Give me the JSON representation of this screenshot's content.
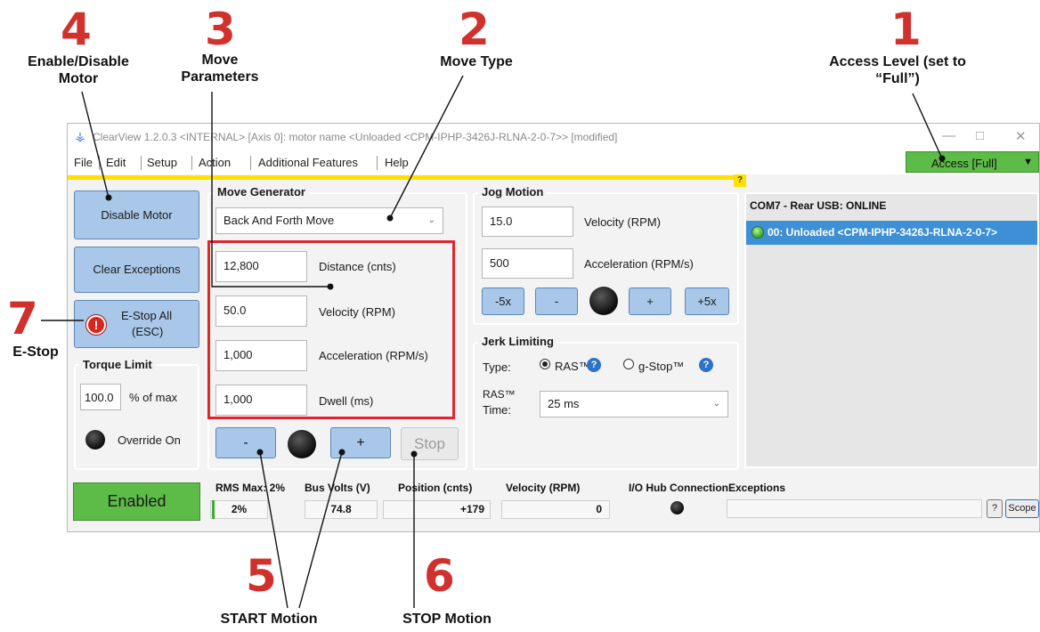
{
  "callouts": [
    {
      "num": "1",
      "label": "Access Level (set to “Full”)"
    },
    {
      "num": "2",
      "label": "Move Type"
    },
    {
      "num": "3",
      "label": "Move Parameters"
    },
    {
      "num": "4",
      "label": "Enable/Disable Motor"
    },
    {
      "num": "5",
      "label": "START Motion"
    },
    {
      "num": "6",
      "label": "STOP Motion"
    },
    {
      "num": "7",
      "label": "E-Stop"
    }
  ],
  "window": {
    "title": "ClearView 1.2.0.3 <INTERNAL> [Axis 0]: motor name <Unloaded <CPM-IPHP-3426J-RLNA-2-0-7>> [modified]",
    "controls": [
      "—",
      "□",
      "✕"
    ]
  },
  "menu": [
    "File",
    "Edit",
    "Setup",
    "Action",
    "Additional Features",
    "Help"
  ],
  "access": {
    "label": "Access [Full]",
    "caret": "▼",
    "color": "#5dbb47"
  },
  "help_marker": "?",
  "left": {
    "disable_motor": "Disable Motor",
    "clear_exceptions": "Clear Exceptions",
    "estop_line1": "E-Stop All",
    "estop_line2": "(ESC)",
    "estop_icon": "!",
    "torque_title": "Torque Limit",
    "torque_value": "100.0",
    "torque_unit": "% of max",
    "override_label": "Override On"
  },
  "move_generator": {
    "title": "Move Generator",
    "move_type": "Back And Forth Move",
    "fields": [
      {
        "value": "12,800",
        "label": "Distance (cnts)"
      },
      {
        "value": "50.0",
        "label": "Velocity (RPM)"
      },
      {
        "value": "1,000",
        "label": "Acceleration (RPM/s)"
      },
      {
        "value": "1,000",
        "label": "Dwell (ms)"
      }
    ],
    "minus": "-",
    "plus": "+",
    "stop": "Stop"
  },
  "jog": {
    "title": "Jog Motion",
    "velocity": "15.0",
    "velocity_label": "Velocity (RPM)",
    "accel": "500",
    "accel_label": "Acceleration (RPM/s)",
    "buttons": [
      "-5x",
      "-",
      "+",
      "+5x"
    ]
  },
  "jerk": {
    "title": "Jerk Limiting",
    "type_label": "Type:",
    "ras": "RAS™",
    "gstop": "g-Stop™",
    "help": "?",
    "time_label_1": "RAS™",
    "time_label_2": "Time:",
    "time_value": "25 ms"
  },
  "device": {
    "header": "COM7 - Rear USB: ONLINE",
    "node": "00: Unloaded <CPM-IPHP-3426J-RLNA-2-0-7>"
  },
  "status": {
    "enabled": "Enabled",
    "rms_label": "RMS Max: 2%",
    "rms_value": "2%",
    "bus_label": "Bus Volts (V)",
    "bus_value": "74.8",
    "pos_label": "Position (cnts)",
    "pos_value": "+179",
    "vel_label": "Velocity (RPM)",
    "vel_value": "0",
    "io_label": "I/O Hub Connection",
    "exc_label": "Exceptions",
    "help": "?",
    "scope": "Scope"
  }
}
